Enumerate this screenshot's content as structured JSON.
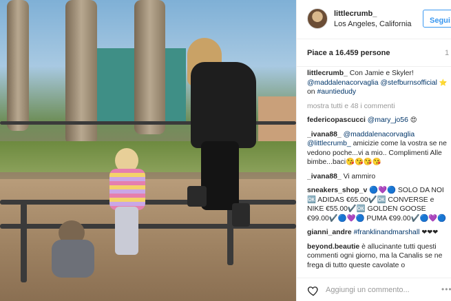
{
  "post": {
    "username": "littlecrumb_",
    "location": "Los Angeles, California",
    "follow_label": "Segui",
    "likes_text": "Piace a 16.459 persone",
    "time_text": "1",
    "avatar_icon": "profile-avatar"
  },
  "caption": {
    "user": "littlecrumb_",
    "text": "Con Jamie e Skyler!",
    "mention1": "@maddalenacorvaglia",
    "mention2": "@stefburnsofficial",
    "star_icon": "⭐",
    "on_text": "on",
    "tag": "#auntiedudy"
  },
  "more_comments": "mostra tutti e 48 i commenti",
  "comments": [
    {
      "user": "federicopascucci",
      "mention": "@mary_jo56",
      "text": "😍"
    },
    {
      "user": "_ivana88_",
      "mention1": "@maddalenacorvaglia",
      "mention2": "@littlecrumb_",
      "text": "amicizie come la vostra se ne vedono poche...vi a mio.. Complimenti Alle bimbe...baci😘😘😘😘"
    },
    {
      "user": "_ivana88_",
      "text": "Vi ammiro"
    },
    {
      "user": "sneakers_shop_v",
      "text": "🔵💜🔵 SOLO DA NOI 🆗 ADIDAS €65.00✔️🆗 CONVERSE e NIKE €55.00✔️🆗 GOLDEN GOOSE €99.00✔️🔵💜🔵 PUMA €99.00✔️🔵💜🔵"
    },
    {
      "user": "gianni_andre",
      "tag": "#franklinandmarshall",
      "text": "❤❤❤"
    },
    {
      "user": "beyond.beautie",
      "text": "è allucinante tutti questi commenti ogni giorno, ma la Canalis se ne frega di tutto queste cavolate o"
    }
  ],
  "footer": {
    "add_comment_placeholder": "Aggiungi un commento...",
    "heart_icon": "heart-outline",
    "more_icon": "ellipsis"
  }
}
